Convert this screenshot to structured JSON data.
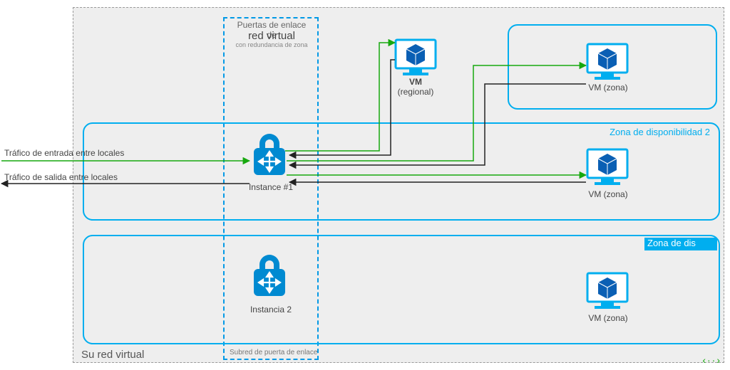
{
  "diagram": {
    "vnet_label": "Su red virtual",
    "gateway_header_line1": "Puertas de enlace de",
    "gateway_header_line2": "red virtual",
    "gateway_header_line3": "con redundancia de zona",
    "gateway_subnet_label": "Subred de puerta de enlace",
    "instance1": "Instance #1",
    "instance2": "Instancia 2",
    "vm_regional_name": "VM",
    "vm_regional_sub": "(regional)",
    "vm_zonal": "VM (zona)",
    "zone_top_title": "",
    "zone_mid_title": "Zona de disponibilidad 2",
    "zone_bot_title": "Zona de dis",
    "traffic_in": "Tráfico de entrada entre locales",
    "traffic_out": "Tráfico de salida entre locales",
    "watermark": "‹··›"
  },
  "colors": {
    "azure_blue": "#00aeef",
    "dark_blue": "#0a5fb4",
    "green": "#17a80e"
  }
}
